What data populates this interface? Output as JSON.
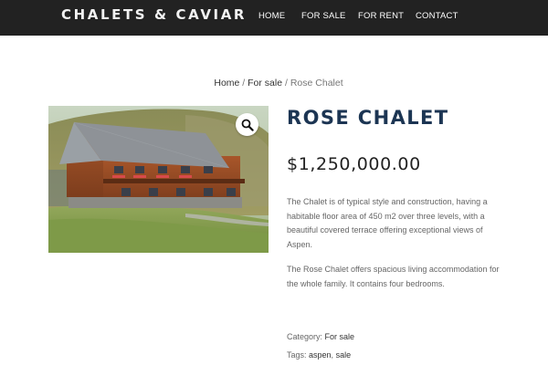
{
  "header": {
    "brand": "CHALETS & CAVIAR",
    "nav": [
      {
        "label": "HOME"
      },
      {
        "label": "FOR SALE"
      },
      {
        "label": "FOR RENT"
      },
      {
        "label": "CONTACT"
      }
    ]
  },
  "breadcrumb": {
    "home": "Home",
    "sep1": " / ",
    "section": "For sale",
    "sep2": " / ",
    "current": "Rose Chalet"
  },
  "product": {
    "title": "ROSE CHALET",
    "price": "$1,250,000.00",
    "description": [
      "The Chalet is of typical style and construction, having a habitable floor area of 450 m2 over three levels, with a beautiful covered terrace offering exceptional views of Aspen.",
      "The Rose Chalet offers spacious living accommodation for the whole family. It contains four bedrooms."
    ],
    "category_label": "Category: ",
    "category": "For sale",
    "tags_label": "Tags: ",
    "tags": [
      "aspen",
      "sale"
    ],
    "tags_sep": ", "
  },
  "icons": {
    "zoom": "magnifier-icon"
  },
  "colors": {
    "header_bg": "#222222",
    "title": "#1c3553",
    "price": "#222222"
  }
}
